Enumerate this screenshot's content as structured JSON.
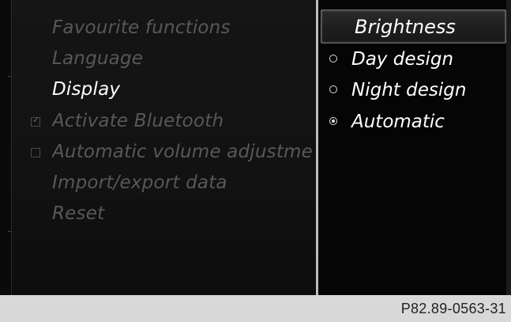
{
  "menu": {
    "items": [
      {
        "label": "Favourite functions",
        "state": "disabled"
      },
      {
        "label": "Language",
        "state": "disabled"
      },
      {
        "label": "Display",
        "state": "active"
      },
      {
        "label": "Activate Bluetooth",
        "state": "disabled",
        "checkbox": "checked"
      },
      {
        "label": "Automatic volume adjustment",
        "state": "disabled",
        "checkbox": "unchecked"
      },
      {
        "label": "Import/export data",
        "state": "disabled"
      },
      {
        "label": "Reset",
        "state": "disabled"
      }
    ]
  },
  "submenu": {
    "header": "Brightness",
    "options": [
      {
        "label": "Day design",
        "selected": false
      },
      {
        "label": "Night design",
        "selected": false
      },
      {
        "label": "Automatic",
        "selected": true
      }
    ]
  },
  "footer": {
    "code": "P82.89-0563-31"
  },
  "colors": {
    "background": "#000000",
    "panel": "#141414",
    "text_active": "#ffffff",
    "text_disabled": "#585858",
    "footer_bg": "#d8d8d8"
  }
}
